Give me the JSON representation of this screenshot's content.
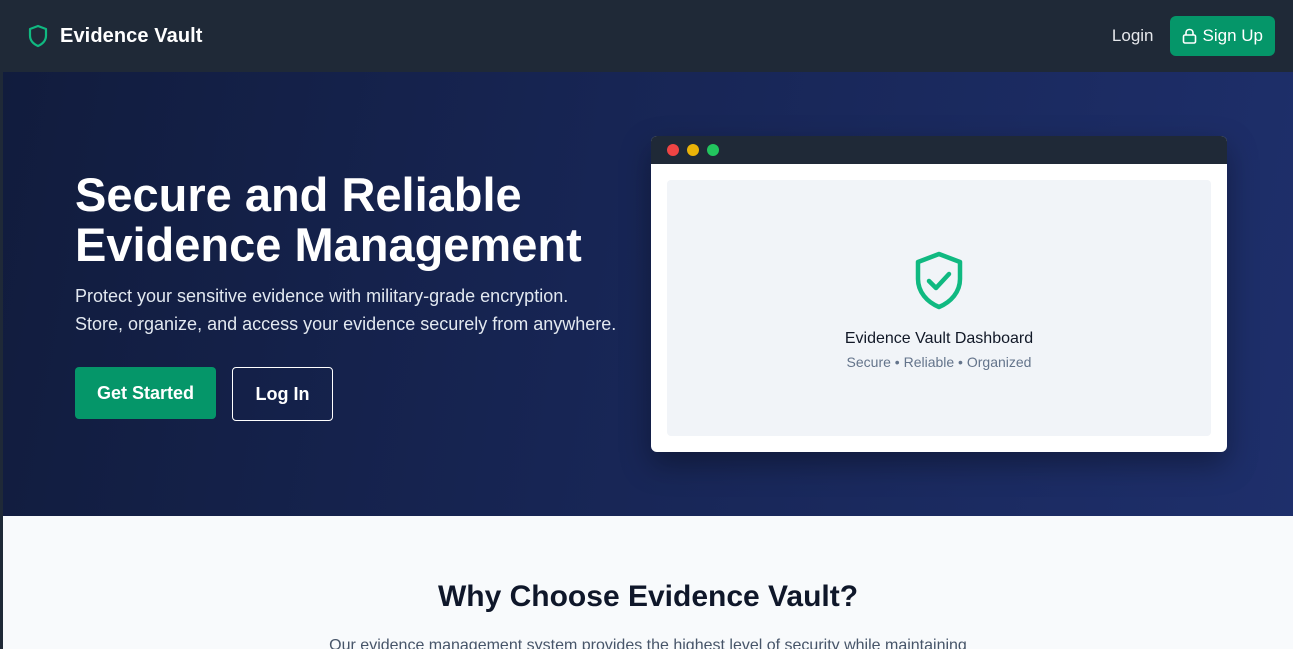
{
  "app": {
    "name": "Evidence Vault"
  },
  "icons": {
    "logo": "shield-icon",
    "signup": "lock-icon",
    "hero_mock": "shield-check-icon"
  },
  "colors": {
    "accent": "#059669",
    "header_bg": "#1f2937",
    "hero_bg": "#172554",
    "shield": "#10b981"
  },
  "nav": {
    "login_label": "Login",
    "signup_label": "Sign Up"
  },
  "hero": {
    "title_line1": "Secure and Reliable",
    "title_line2": "Evidence Management",
    "subtitle_line1": "Protect your sensitive evidence with military-grade encryption.",
    "subtitle_line2": "Store, organize, and access your evidence securely from anywhere.",
    "primary_cta": "Get Started",
    "secondary_cta": "Log In"
  },
  "mockup": {
    "title": "Evidence Vault Dashboard",
    "subtitle": "Secure • Reliable • Organized"
  },
  "features": {
    "title": "Why Choose Evidence Vault?",
    "subtitle": "Our evidence management system provides the highest level of security while maintaining"
  }
}
